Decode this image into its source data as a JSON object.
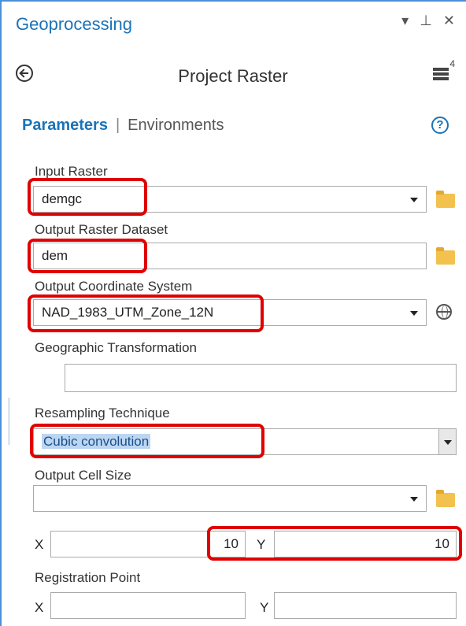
{
  "pane": {
    "title": "Geoprocessing",
    "pin_glyph": "▾  ⫞",
    "close_glyph": "✕"
  },
  "tool": {
    "title": "Project Raster",
    "menu_badge": "4"
  },
  "tabs": {
    "parameters": "Parameters",
    "environments": "Environments",
    "help": "?"
  },
  "fields": {
    "input_raster": {
      "label": "Input Raster",
      "value": "demgc"
    },
    "output_raster": {
      "label": "Output Raster Dataset",
      "value": "dem"
    },
    "output_cs": {
      "label": "Output Coordinate System",
      "value": "NAD_1983_UTM_Zone_12N"
    },
    "geo_transform": {
      "label": "Geographic Transformation",
      "value": ""
    },
    "resampling": {
      "label": "Resampling Technique",
      "value": "Cubic convolution"
    },
    "cell_size": {
      "label": "Output Cell Size",
      "value": ""
    },
    "cell_x": {
      "label": "X",
      "value": "10"
    },
    "cell_y": {
      "label": "Y",
      "value": "10"
    },
    "registration": {
      "label": "Registration Point",
      "x_label": "X",
      "y_label": "Y",
      "x_value": "",
      "y_value": ""
    }
  },
  "colors": {
    "accent": "#1a73b8",
    "highlight": "#e00000",
    "selection": "#bcd6f1"
  }
}
